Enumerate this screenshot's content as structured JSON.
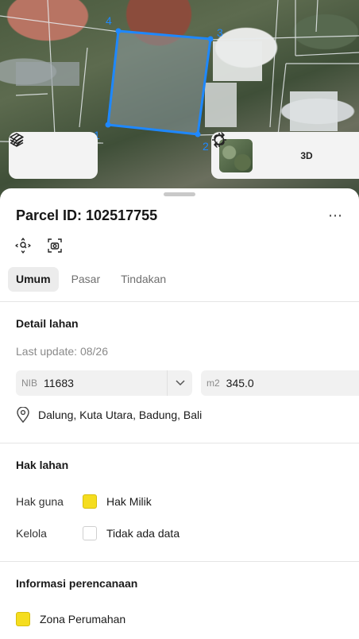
{
  "map": {
    "vertex_labels": [
      "4",
      "3",
      "1",
      "2"
    ],
    "parcel_color": "#1e88ff",
    "controls_left": [
      "layers-icon",
      "draw-icon"
    ],
    "controls_right": [
      "satellite-thumbnail",
      "locate-icon",
      "3d-button",
      "rotate-icon"
    ],
    "three_d_label": "3D"
  },
  "sheet": {
    "title": "Parcel ID: 102517755",
    "more_label": "⋯",
    "actions": [
      "recenter-icon",
      "screenshot-icon"
    ],
    "tabs": [
      {
        "label": "Umum",
        "active": true
      },
      {
        "label": "Pasar",
        "active": false
      },
      {
        "label": "Tindakan",
        "active": false
      }
    ],
    "detail": {
      "heading": "Detail lahan",
      "last_update": "Last update: 08/26",
      "nib_label": "NIB",
      "nib_value": "11683",
      "area_label": "m2",
      "area_value": "345.0",
      "location": "Dalung, Kuta Utara, Badung, Bali"
    },
    "rights": {
      "heading": "Hak lahan",
      "rows": [
        {
          "key": "Hak guna",
          "value": "Hak Milik",
          "swatch": "#f5dd1f"
        },
        {
          "key": "Kelola",
          "value": "Tidak ada data",
          "swatch": "none"
        }
      ]
    },
    "planning": {
      "heading": "Informasi perencanaan",
      "zone": "Zona Perumahan",
      "zone_color": "#f5dd1f"
    }
  }
}
